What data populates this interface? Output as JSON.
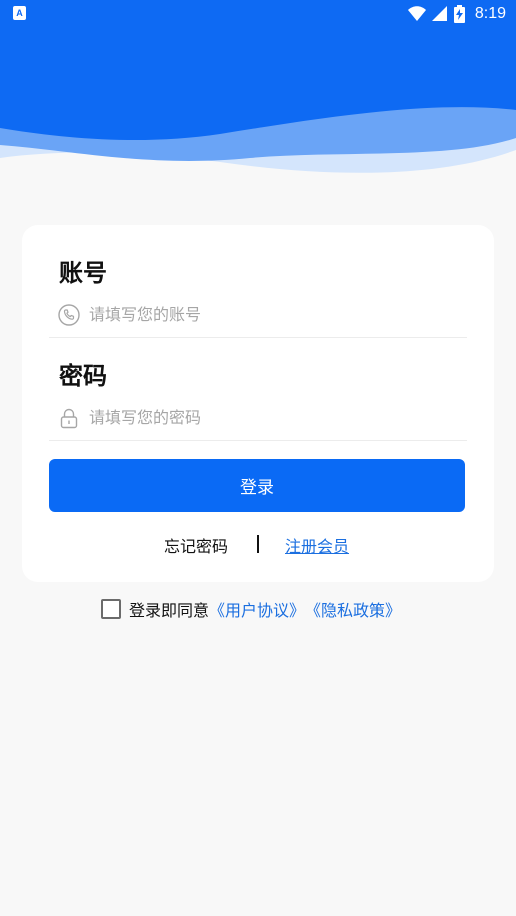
{
  "status_bar": {
    "app_icon_letter": "A",
    "time": "8:19",
    "icons": [
      "wifi-icon",
      "signal-icon",
      "battery-charging-icon"
    ]
  },
  "colors": {
    "primary": "#0a6af5",
    "link": "#1b6fe0",
    "background": "#f8f8f8",
    "hero_blue": "#0e6af3"
  },
  "login_form": {
    "account": {
      "label": "账号",
      "placeholder": "请填写您的账号",
      "value": "",
      "icon": "phone-icon"
    },
    "password": {
      "label": "密码",
      "placeholder": "请填写您的密码",
      "value": "",
      "icon": "lock-icon"
    },
    "submit_label": "登录",
    "forgot_label": "忘记密码",
    "divider": "|",
    "register_label": "注册会员"
  },
  "agreement": {
    "checked": false,
    "prefix": "登录即同意",
    "user_agreement": "《用户协议》",
    "privacy_policy": "《隐私政策》"
  }
}
